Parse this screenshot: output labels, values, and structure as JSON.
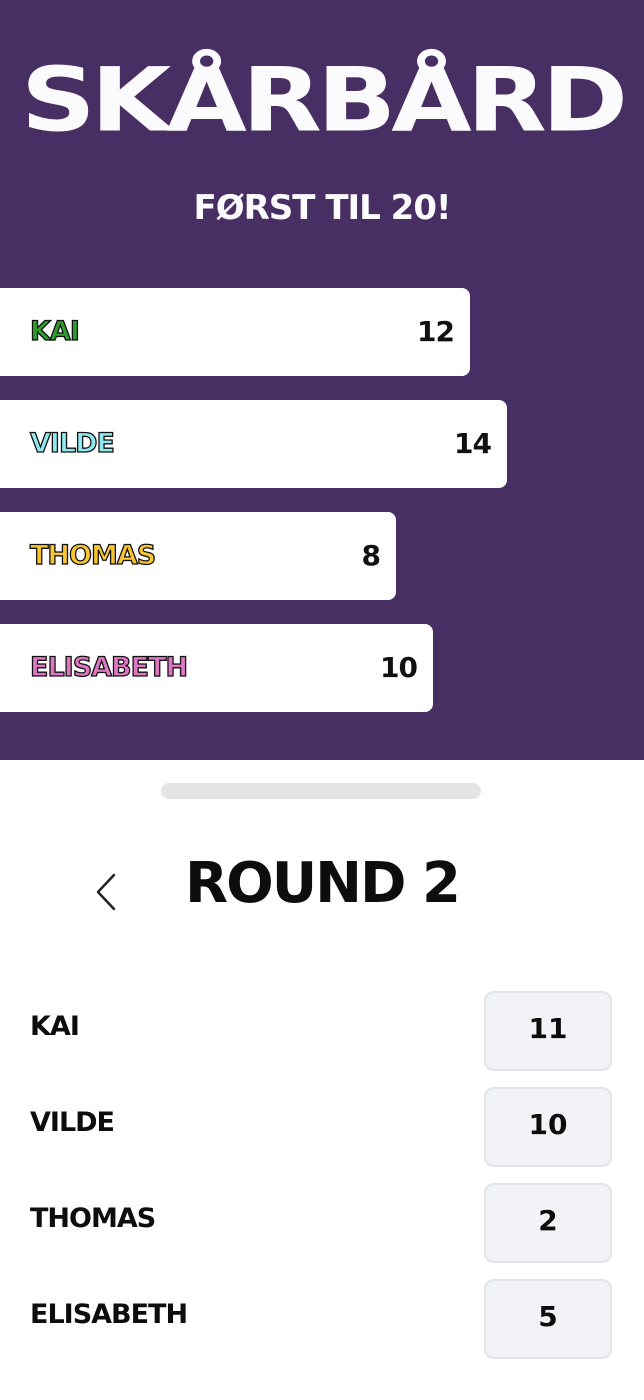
{
  "header": {
    "title": "SKÅRBÅRD",
    "subtitle": "FØRST TIL 20!"
  },
  "scoreboard": [
    {
      "name": "KAI",
      "score": "12",
      "color": "#2e9b2e"
    },
    {
      "name": "VILDE",
      "score": "14",
      "color": "#8ee8ee"
    },
    {
      "name": "THOMAS",
      "score": "8",
      "color": "#f7c531"
    },
    {
      "name": "ELISABETH",
      "score": "10",
      "color": "#dd77c3"
    }
  ],
  "round": {
    "title": "ROUND 2",
    "back_icon": "chevron-left-icon",
    "entries": [
      {
        "name": "KAI",
        "value": "11"
      },
      {
        "name": "VILDE",
        "value": "10"
      },
      {
        "name": "THOMAS",
        "value": "2"
      },
      {
        "name": "ELISABETH",
        "value": "5"
      }
    ]
  },
  "colors": {
    "header_background": "#472e63",
    "sheet_background": "#ffffff",
    "input_background": "#f1f3f7"
  }
}
